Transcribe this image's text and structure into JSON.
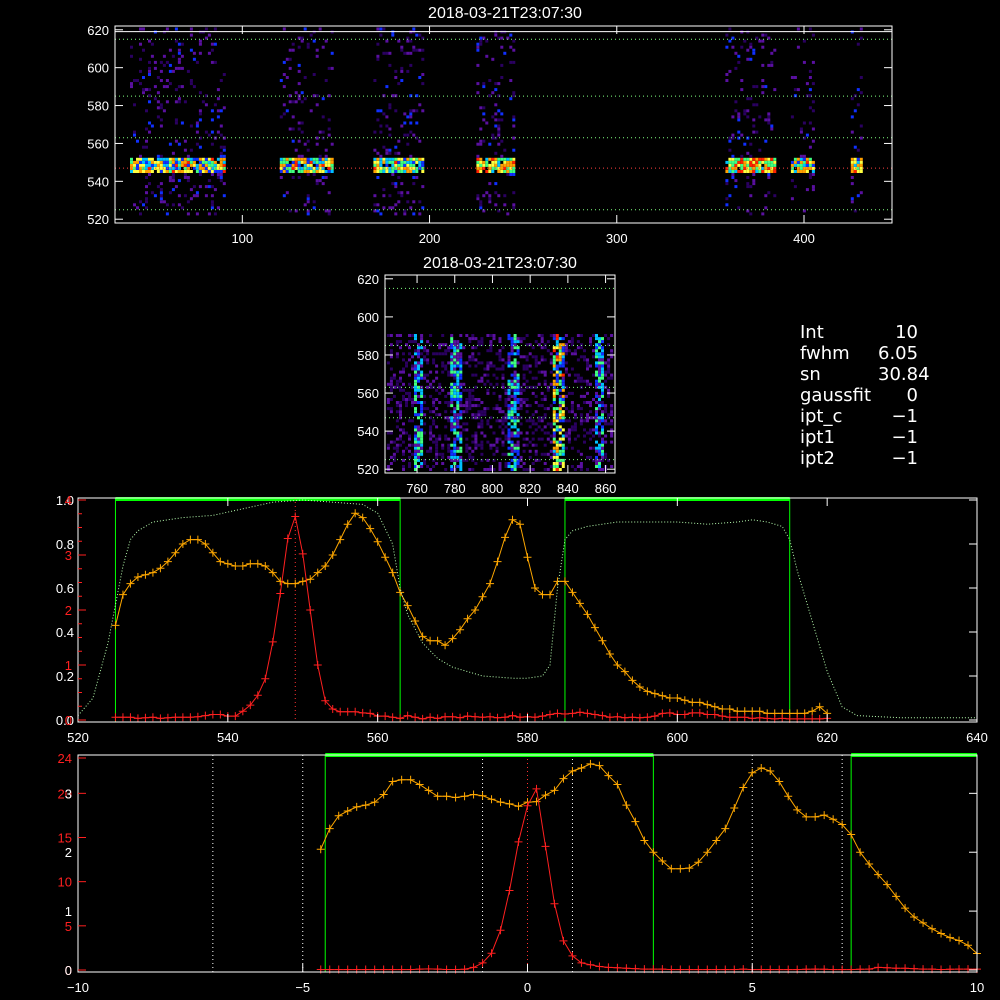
{
  "chart_data": [
    {
      "type": "heatmap",
      "title": "2018-03-21T23:07:30",
      "xlim": [
        32,
        447
      ],
      "ylim": [
        518,
        622
      ],
      "x_ticks": [
        100,
        200,
        300,
        400
      ],
      "y_ticks": [
        520,
        540,
        560,
        580,
        600,
        620
      ],
      "guide_lines_y": [
        525,
        547,
        563,
        585,
        615,
        619
      ],
      "bright_band_y": 547,
      "column_groups": [
        [
          40,
          90
        ],
        [
          120,
          148
        ],
        [
          170,
          196
        ],
        [
          225,
          245
        ],
        [
          358,
          385
        ],
        [
          393,
          405
        ],
        [
          425,
          430
        ]
      ],
      "colormap": [
        "#2a0060",
        "#5a10a0",
        "#1030ff",
        "#00c0ff",
        "#40ff80",
        "#ffff40",
        "#ffa000",
        "#ff2000"
      ]
    },
    {
      "type": "heatmap",
      "title": "2018-03-21T23:07:30",
      "xlim": [
        743,
        865
      ],
      "ylim": [
        518,
        622
      ],
      "x_ticks": [
        760,
        780,
        800,
        820,
        840,
        860
      ],
      "y_ticks": [
        520,
        540,
        560,
        580,
        600,
        620
      ],
      "guide_lines_y": [
        525,
        547,
        563,
        585,
        615
      ],
      "streak_x": [
        760,
        780,
        810,
        835,
        856
      ]
    },
    {
      "type": "line",
      "xlim": [
        520,
        640
      ],
      "x_ticks": [
        520,
        540,
        560,
        580,
        600,
        620,
        640
      ],
      "left_ticks_red": [
        0,
        1,
        2,
        3,
        4
      ],
      "left_ticks_white": [
        0.0,
        0.2,
        0.4,
        0.6,
        0.8,
        1.0
      ],
      "vline": 549,
      "windows": [
        [
          525,
          563
        ],
        [
          585,
          615
        ]
      ],
      "series": [
        {
          "color": "#ffa800",
          "x": [
            525,
            526,
            527,
            528,
            529,
            530,
            531,
            532,
            533,
            534,
            535,
            536,
            537,
            538,
            539,
            540,
            541,
            542,
            543,
            544,
            545,
            546,
            547,
            548,
            549,
            550,
            551,
            552,
            553,
            554,
            555,
            556,
            557,
            558,
            559,
            560,
            561,
            562,
            563,
            564,
            565,
            566,
            567,
            568,
            569,
            570,
            571,
            572,
            573,
            574,
            575,
            576,
            577,
            578,
            579,
            580,
            581,
            582,
            583,
            584,
            585,
            586,
            587,
            588,
            589,
            590,
            591,
            592,
            593,
            594,
            595,
            596,
            597,
            598,
            599,
            600,
            601,
            602,
            603,
            604,
            605,
            606,
            607,
            608,
            609,
            610,
            611,
            612,
            613,
            614,
            615,
            616,
            617,
            618,
            619,
            620
          ],
          "y": [
            0.43,
            0.57,
            0.62,
            0.65,
            0.66,
            0.67,
            0.69,
            0.72,
            0.76,
            0.8,
            0.82,
            0.82,
            0.8,
            0.76,
            0.72,
            0.71,
            0.7,
            0.7,
            0.71,
            0.71,
            0.7,
            0.67,
            0.63,
            0.62,
            0.62,
            0.63,
            0.64,
            0.67,
            0.7,
            0.75,
            0.82,
            0.89,
            0.94,
            0.92,
            0.87,
            0.81,
            0.74,
            0.67,
            0.58,
            0.52,
            0.45,
            0.38,
            0.36,
            0.36,
            0.34,
            0.37,
            0.41,
            0.46,
            0.5,
            0.56,
            0.62,
            0.72,
            0.83,
            0.91,
            0.89,
            0.74,
            0.6,
            0.57,
            0.57,
            0.63,
            0.63,
            0.58,
            0.53,
            0.48,
            0.42,
            0.36,
            0.3,
            0.25,
            0.22,
            0.18,
            0.15,
            0.13,
            0.12,
            0.11,
            0.1,
            0.1,
            0.09,
            0.08,
            0.08,
            0.07,
            0.06,
            0.05,
            0.05,
            0.04,
            0.04,
            0.04,
            0.04,
            0.03,
            0.03,
            0.03,
            0.03,
            0.03,
            0.03,
            0.04,
            0.06,
            0.03
          ]
        },
        {
          "color": "#ff2020",
          "x": [
            525,
            526,
            527,
            528,
            529,
            530,
            531,
            532,
            533,
            534,
            535,
            536,
            537,
            538,
            539,
            540,
            541,
            542,
            543,
            544,
            545,
            546,
            547,
            548,
            549,
            550,
            551,
            552,
            553,
            554,
            555,
            556,
            557,
            558,
            559,
            560,
            561,
            562,
            563,
            564,
            565,
            566,
            567,
            568,
            569,
            570,
            571,
            572,
            573,
            574,
            575,
            576,
            577,
            578,
            579,
            580,
            581,
            582,
            583,
            584,
            585,
            586,
            587,
            588,
            589,
            590,
            591,
            592,
            593,
            594,
            595,
            596,
            597,
            598,
            599,
            600,
            601,
            602,
            603,
            604,
            605,
            606,
            607,
            608,
            609,
            610,
            611,
            612,
            613,
            614,
            615,
            616,
            617,
            618,
            619,
            620
          ],
          "y": [
            0.05,
            0.05,
            0.05,
            0.03,
            0.04,
            0.05,
            0.03,
            0.04,
            0.05,
            0.05,
            0.05,
            0.06,
            0.08,
            0.1,
            0.1,
            0.07,
            0.07,
            0.16,
            0.27,
            0.45,
            0.75,
            1.42,
            2.3,
            3.3,
            3.7,
            3.02,
            2.0,
            1.0,
            0.35,
            0.2,
            0.15,
            0.15,
            0.15,
            0.13,
            0.12,
            0.07,
            0.07,
            0.05,
            0.03,
            0.08,
            0.05,
            0.02,
            0.05,
            0.03,
            0.06,
            0.06,
            0.04,
            0.07,
            0.06,
            0.05,
            0.06,
            0.04,
            0.05,
            0.08,
            0.05,
            0.06,
            0.05,
            0.07,
            0.1,
            0.12,
            0.11,
            0.12,
            0.14,
            0.12,
            0.1,
            0.08,
            0.05,
            0.06,
            0.04,
            0.05,
            0.04,
            0.05,
            0.07,
            0.12,
            0.13,
            0.1,
            0.1,
            0.13,
            0.13,
            0.1,
            0.1,
            0.07,
            0.05,
            0.05,
            0.05,
            0.03,
            0.04,
            0.03,
            0.02,
            0.03,
            0.02,
            0.02,
            0.02,
            0.02,
            0.02,
            0.03
          ]
        },
        {
          "color": "#b8ffb0",
          "x": [
            520,
            522,
            524,
            526,
            527,
            528,
            530,
            534,
            538,
            542,
            546,
            550,
            554,
            558,
            560,
            562,
            563,
            564,
            566,
            568,
            570,
            572,
            574,
            578,
            580,
            582,
            583,
            584,
            585,
            586,
            588,
            592,
            596,
            600,
            604,
            608,
            610,
            612,
            614,
            615,
            616,
            618,
            620,
            622,
            624,
            630,
            636,
            640
          ],
          "y": [
            0.02,
            0.1,
            0.35,
            0.7,
            0.82,
            0.86,
            0.9,
            0.92,
            0.93,
            0.96,
            0.99,
            1.0,
            0.99,
            0.98,
            0.94,
            0.8,
            0.6,
            0.48,
            0.35,
            0.28,
            0.24,
            0.22,
            0.2,
            0.19,
            0.19,
            0.2,
            0.25,
            0.6,
            0.82,
            0.86,
            0.88,
            0.9,
            0.9,
            0.9,
            0.89,
            0.9,
            0.91,
            0.9,
            0.88,
            0.82,
            0.68,
            0.45,
            0.22,
            0.06,
            0.02,
            0.01,
            0.01,
            0.01
          ]
        }
      ]
    },
    {
      "type": "line",
      "xlim": [
        -10,
        10
      ],
      "x_ticks": [
        -10,
        -5,
        0,
        5,
        10
      ],
      "left_ticks_red": [
        0,
        5,
        10,
        15,
        20,
        24
      ],
      "left_ticks_white": [
        0,
        1,
        2,
        3
      ],
      "vlines_white": [
        -7,
        -5,
        -1,
        1,
        5,
        7
      ],
      "vline_red": 0,
      "windows": [
        [
          -4.5,
          2.8
        ],
        [
          7.2,
          10
        ]
      ],
      "series": [
        {
          "color": "#ffa800",
          "x": [
            -4.6,
            -4.4,
            -4.2,
            -4.0,
            -3.8,
            -3.6,
            -3.4,
            -3.2,
            -3.0,
            -2.8,
            -2.6,
            -2.4,
            -2.2,
            -2.0,
            -1.8,
            -1.6,
            -1.4,
            -1.2,
            -1.0,
            -0.8,
            -0.6,
            -0.4,
            -0.2,
            0.0,
            0.2,
            0.4,
            0.6,
            0.8,
            1.0,
            1.2,
            1.4,
            1.6,
            1.8,
            2.0,
            2.2,
            2.4,
            2.6,
            2.8,
            3.0,
            3.2,
            3.4,
            3.6,
            3.8,
            4.0,
            4.2,
            4.4,
            4.6,
            4.8,
            5.0,
            5.2,
            5.4,
            5.6,
            5.8,
            6.0,
            6.2,
            6.4,
            6.6,
            6.8,
            7.0,
            7.2,
            7.4,
            7.6,
            7.8,
            8.0,
            8.2,
            8.4,
            8.6,
            8.8,
            9.0,
            9.2,
            9.4,
            9.6,
            9.8,
            10.0
          ],
          "y": [
            2.05,
            2.4,
            2.62,
            2.7,
            2.77,
            2.8,
            2.85,
            2.98,
            3.2,
            3.23,
            3.23,
            3.15,
            3.05,
            2.95,
            2.95,
            2.93,
            2.95,
            2.98,
            2.96,
            2.9,
            2.85,
            2.82,
            2.78,
            2.85,
            2.86,
            2.97,
            3.05,
            3.25,
            3.38,
            3.43,
            3.5,
            3.47,
            3.3,
            3.15,
            2.8,
            2.52,
            2.2,
            2.0,
            1.85,
            1.72,
            1.72,
            1.73,
            1.83,
            2.0,
            2.2,
            2.4,
            2.75,
            3.1,
            3.35,
            3.43,
            3.38,
            3.2,
            2.95,
            2.72,
            2.6,
            2.6,
            2.63,
            2.56,
            2.47,
            2.3,
            2.0,
            1.8,
            1.62,
            1.45,
            1.25,
            1.05,
            0.9,
            0.8,
            0.7,
            0.62,
            0.55,
            0.5,
            0.42,
            0.28
          ]
        },
        {
          "color": "#ff2020",
          "x": [
            -4.6,
            -4.4,
            -4.2,
            -4.0,
            -3.8,
            -3.6,
            -3.4,
            -3.2,
            -3.0,
            -2.8,
            -2.6,
            -2.4,
            -2.2,
            -2.0,
            -1.8,
            -1.6,
            -1.4,
            -1.2,
            -1.0,
            -0.8,
            -0.6,
            -0.4,
            -0.2,
            0.0,
            0.2,
            0.4,
            0.6,
            0.8,
            1.0,
            1.2,
            1.4,
            1.6,
            1.8,
            2.0,
            2.2,
            2.4,
            2.6,
            2.8,
            3.0,
            3.2,
            3.4,
            3.6,
            3.8,
            4.0,
            4.2,
            4.4,
            4.6,
            4.8,
            5.0,
            5.2,
            5.4,
            5.6,
            5.8,
            6.0,
            6.2,
            6.4,
            6.6,
            6.8,
            7.0,
            7.2,
            7.4,
            7.6,
            7.8,
            8.0,
            8.2,
            8.4,
            8.6,
            8.8,
            9.0,
            9.2,
            9.4,
            9.6,
            9.8,
            10.0
          ],
          "y": [
            0.05,
            0.05,
            0.05,
            0.05,
            0.05,
            0.05,
            0.05,
            0.05,
            0.05,
            0.05,
            0.05,
            0.1,
            0.12,
            0.1,
            0.06,
            0.06,
            0.08,
            0.3,
            0.8,
            1.9,
            4.5,
            9.0,
            14.5,
            18.6,
            20.5,
            14.0,
            7.5,
            3.3,
            1.6,
            0.8,
            0.6,
            0.4,
            0.3,
            0.25,
            0.2,
            0.15,
            0.1,
            0.1,
            0.1,
            0.05,
            0.05,
            0.05,
            0.05,
            0.05,
            0.05,
            0.05,
            0.05,
            0.1,
            0.05,
            0.05,
            0.05,
            0.05,
            0.05,
            0.05,
            0.08,
            0.1,
            0.08,
            0.05,
            0.05,
            0.05,
            0.08,
            0.1,
            0.3,
            0.25,
            0.2,
            0.2,
            0.15,
            0.1,
            0.1,
            0.05,
            0.08,
            0.1,
            0.1,
            0.1
          ]
        }
      ]
    }
  ],
  "info": [
    {
      "key": "Int",
      "value": "10"
    },
    {
      "key": "fwhm",
      "value": "6.05"
    },
    {
      "key": "sn",
      "value": "30.84"
    },
    {
      "key": "gaussfit",
      "value": "0"
    },
    {
      "key": "ipt_c",
      "value": "−1"
    },
    {
      "key": "ipt1",
      "value": "−1"
    },
    {
      "key": "ipt2",
      "value": "−1"
    }
  ],
  "colors": {
    "axis": "#ffffff",
    "window": "#00ff00",
    "red_axis": "#ff2020",
    "guide": "#ffffff"
  }
}
